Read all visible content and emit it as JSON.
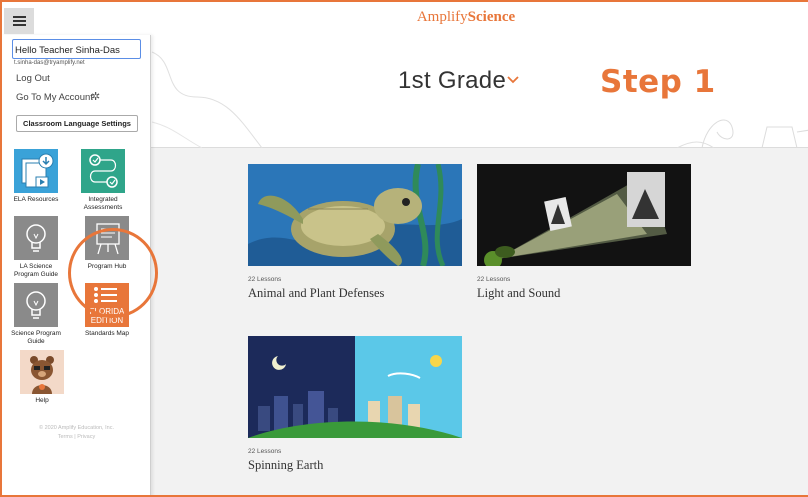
{
  "brand": {
    "part1": "Amplify",
    "part2": "Science",
    "color": "#e8763a"
  },
  "header": {
    "grade_label": "1st Grade",
    "step_label": "Step 1"
  },
  "menu": {
    "icon": "hamburger-icon"
  },
  "sidebar": {
    "user_greeting": "Hello Teacher Sinha-Das",
    "user_email": "t.sinha-das@tryamplify.net",
    "log_out": "Log Out",
    "account": "Go To My Account",
    "language_button": "Classroom Language Settings",
    "tiles": [
      {
        "label": "ELA Resources",
        "icon": "ela-resources-icon"
      },
      {
        "label_1": "Integrated",
        "label_2": "Assessments",
        "icon": "assessments-icon"
      },
      {
        "label_1": "LA Science",
        "label_2": "Program Guide",
        "icon": "lightbulb-icon"
      },
      {
        "label": "Program Hub",
        "icon": "program-hub-icon"
      },
      {
        "label_1": "Science Program",
        "label_2": "Guide",
        "icon": "lightbulb-icon"
      },
      {
        "label": "Standards Map",
        "icon": "standards-map-icon",
        "badge_1": "FLORIDA",
        "badge_2": "EDITION"
      },
      {
        "label": "Help",
        "icon": "help-bear-icon"
      }
    ],
    "copyright": "© 2020 Amplify Education, Inc.",
    "terms": "Terms | Privacy"
  },
  "units": [
    {
      "lessons": "22 Lessons",
      "title": "Animal and Plant Defenses"
    },
    {
      "lessons": "22 Lessons",
      "title": "Light and Sound"
    },
    {
      "lessons": "22 Lessons",
      "title": "Spinning Earth"
    }
  ]
}
